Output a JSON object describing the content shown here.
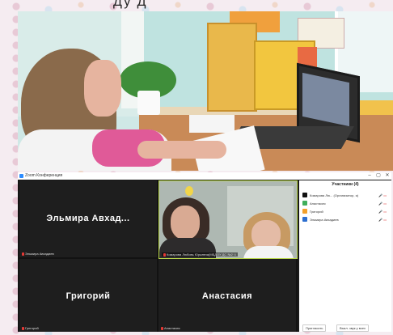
{
  "caption": "Ду          Д",
  "zoom": {
    "window_title": "Zoom Конференция",
    "controls": [
      "–",
      "▢",
      "✕"
    ],
    "tiles": [
      {
        "name": "Эльмира  Авхад...",
        "tag": "Эльмира Авхадиев"
      },
      {
        "name": "",
        "tag": "Комарова Любовь Юрьевна(МБДОУ ДС №2 Ч"
      },
      {
        "name": "Григорий",
        "tag": "Григорий"
      },
      {
        "name": "Анастасия",
        "tag": "Анастасия"
      }
    ],
    "participants_panel": {
      "title": "Участники (4)",
      "rows": [
        {
          "name": "Комарова Лю... (Организатор, я)",
          "avatar_color": "#111111"
        },
        {
          "name": "Анастасия",
          "avatar_color": "#3fae5a"
        },
        {
          "name": "Григорий",
          "avatar_color": "#f2a02a"
        },
        {
          "name": "Эльмира Авхадиев",
          "avatar_color": "#2d6fd0"
        }
      ],
      "footer_buttons": [
        "Пригласить",
        "Выкл. звук у всех"
      ]
    }
  },
  "colors": {
    "active_speaker": "#b9d74a",
    "mic_off": "#e53935"
  }
}
